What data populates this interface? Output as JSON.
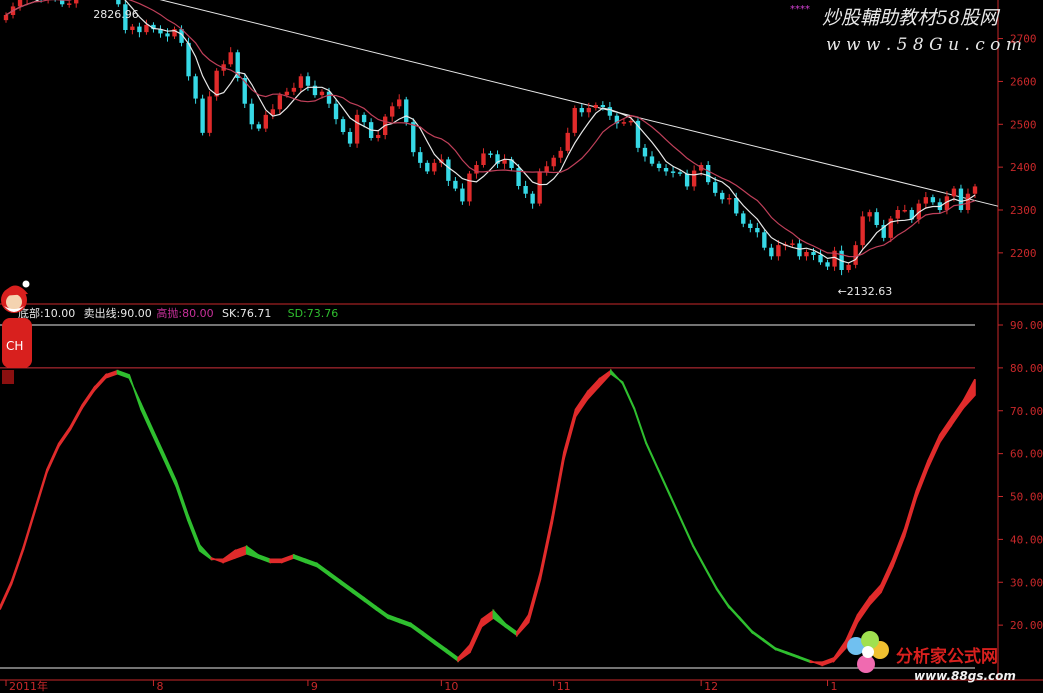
{
  "header": {
    "text": "",
    "stars": "****"
  },
  "watermark_top": {
    "line1": "炒股輔助教材58股网",
    "line2": "w w w . 5 8 G u . c o m"
  },
  "watermark_bottom": {
    "line1": "分析家公式网",
    "line2": "www.88gs.com"
  },
  "colors": {
    "up": "#e02b2b",
    "down": "#37d9e6",
    "green": "#2fbf2f",
    "axis": "#c8282a",
    "ma_white": "#e8e8e8",
    "ma_red": "#c0405a"
  },
  "chart_data": [
    {
      "type": "candlestick",
      "title": "",
      "yticks": [
        2200,
        2300,
        2400,
        2500,
        2600,
        2700
      ],
      "ylim": [
        2090,
        2790
      ],
      "annotations": {
        "high": "2826.96",
        "low": "←2132.63"
      },
      "closes": [
        2755,
        2775,
        2790,
        2800,
        2808,
        2792,
        2812,
        2798,
        2780,
        2782,
        2808,
        2805,
        2812,
        2822,
        2815,
        2810,
        2780,
        2720,
        2728,
        2715,
        2732,
        2722,
        2712,
        2705,
        2722,
        2690,
        2612,
        2560,
        2480,
        2565,
        2625,
        2640,
        2668,
        2608,
        2548,
        2500,
        2490,
        2522,
        2535,
        2568,
        2576,
        2585,
        2612,
        2590,
        2568,
        2576,
        2548,
        2512,
        2482,
        2455,
        2522,
        2505,
        2468,
        2475,
        2518,
        2542,
        2558,
        2505,
        2435,
        2410,
        2390,
        2410,
        2418,
        2368,
        2350,
        2320,
        2385,
        2405,
        2432,
        2430,
        2408,
        2418,
        2398,
        2356,
        2338,
        2315,
        2388,
        2402,
        2422,
        2438,
        2480,
        2538,
        2528,
        2538,
        2545,
        2540,
        2520,
        2502,
        2505,
        2508,
        2445,
        2425,
        2408,
        2398,
        2390,
        2388,
        2385,
        2355,
        2392,
        2405,
        2365,
        2340,
        2325,
        2328,
        2292,
        2268,
        2258,
        2248,
        2212,
        2192,
        2218,
        2220,
        2222,
        2192,
        2202,
        2195,
        2178,
        2168,
        2205,
        2160,
        2172,
        2218,
        2285,
        2295,
        2265,
        2235,
        2280,
        2300,
        2300,
        2278,
        2315,
        2330,
        2318,
        2300,
        2332,
        2350,
        2300,
        2338,
        2355
      ],
      "trendline": {
        "start": {
          "i": 13,
          "v": 2827
        },
        "end": {
          "i": 141,
          "v": 2310
        }
      }
    },
    {
      "type": "line",
      "legend": [
        {
          "name": "底部:10.00",
          "color": "#e8e8e8"
        },
        {
          "name": "卖出线:90.00",
          "color": "#e8e8e8"
        },
        {
          "name": "高抛:80.00",
          "color": "#c8309a"
        },
        {
          "name": "SK:76.71",
          "color": "#e8e8e8"
        },
        {
          "name": "SD:73.76",
          "color": "#2fbf2f"
        }
      ],
      "yticks": [
        20,
        30,
        40,
        50,
        60,
        70,
        80,
        90
      ],
      "ylim": [
        10,
        92
      ],
      "hlines": [
        {
          "value": 90,
          "color": "#e8e8e8"
        },
        {
          "value": 80,
          "color": "#d0303a"
        },
        {
          "value": 10,
          "color": "#e8e8e8"
        }
      ],
      "sk": [
        24,
        30,
        38,
        47,
        56,
        62,
        66,
        71,
        75,
        78,
        79,
        78,
        70,
        64,
        58,
        52,
        44,
        37,
        35,
        35,
        37,
        38,
        36,
        35,
        35,
        36,
        35,
        34,
        32,
        30,
        28,
        26,
        24,
        22,
        21,
        20,
        18,
        16,
        14,
        12,
        15,
        21,
        23,
        20,
        18,
        22,
        32,
        45,
        60,
        70,
        74,
        77,
        79,
        76,
        70,
        62,
        56,
        50,
        44,
        38,
        33,
        28,
        24,
        21,
        18,
        16,
        14,
        13,
        12,
        11,
        11,
        12,
        16,
        22,
        26,
        29,
        35,
        42,
        51,
        58,
        64,
        68,
        72,
        77
      ],
      "sd": [
        24,
        30,
        38,
        47,
        56,
        62,
        66,
        71,
        75,
        78,
        79,
        78,
        72,
        66,
        60,
        54,
        46,
        39,
        36,
        35,
        36,
        37,
        36,
        35,
        35,
        36,
        35,
        34,
        32,
        30,
        28,
        26,
        24,
        22,
        21,
        20,
        18,
        16,
        14,
        12,
        14,
        20,
        22,
        20,
        18,
        21,
        31,
        44,
        59,
        69,
        73,
        76,
        79,
        77,
        71,
        63,
        57,
        51,
        45,
        39,
        34,
        29,
        25,
        22,
        19,
        17,
        15,
        14,
        13,
        12,
        11,
        12,
        15,
        21,
        25,
        28,
        34,
        41,
        50,
        57,
        63,
        67,
        71,
        74
      ]
    }
  ],
  "x_axis": {
    "labels": [
      "2011年",
      "8",
      "9",
      "10",
      "11",
      "12",
      "1"
    ]
  }
}
